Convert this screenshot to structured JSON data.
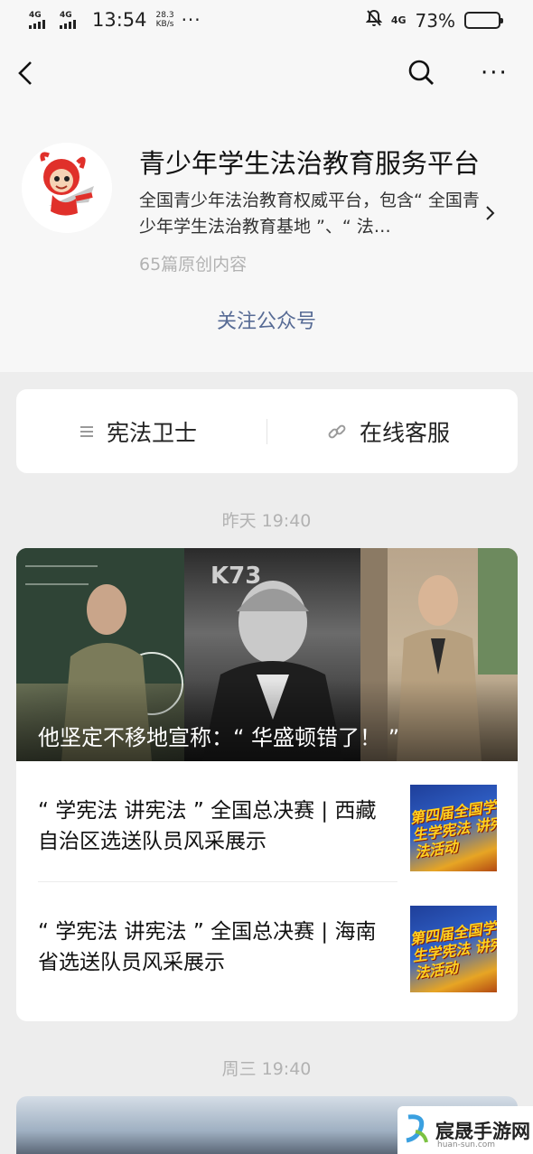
{
  "status_bar": {
    "sim1_network": "4G",
    "sim2_network": "4G",
    "time": "13:54",
    "speed_value": "28.3",
    "speed_unit": "KB/s",
    "dots": "···",
    "signal_right": "4G",
    "battery_text": "73%",
    "battery_level": 0.73
  },
  "nav": {
    "back_icon": "chevron-left-icon",
    "search_icon": "search-icon",
    "more_icon": "more-icon",
    "more_text": "···"
  },
  "account": {
    "name": "青少年学生法治教育服务平台",
    "description": "全国青少年法治教育权威平台，包含“ 全国青少年学生法治教育基地 ”、“ 法…",
    "article_count": "65篇原创内容",
    "follow_label": "关注公众号"
  },
  "menu": {
    "item1_label": "宪法卫士",
    "item1_icon": "list-icon",
    "item2_label": "在线客服",
    "item2_icon": "link-icon"
  },
  "feed": {
    "group1_date": "昨天 19:40",
    "cover_title": "他坚定不移地宣称：“ 华盛顿错了！ ”",
    "watermark": "K73",
    "articles": [
      {
        "title": "“ 学宪法 讲宪法 ”  全国总决赛 | 西藏自治区选送队员风采展示",
        "thumb_text": "第四届全国学生学宪法 讲宪法活动"
      },
      {
        "title": "“ 学宪法 讲宪法 ”  全国总决赛 | 海南省选送队员风采展示",
        "thumb_text": "第四届全国学生学宪法 讲宪法活动"
      }
    ],
    "group2_date": "周三 19:40"
  },
  "watermark_badge": {
    "text": "宸晟手游网",
    "sub": "huan-sun.com"
  },
  "colors": {
    "link": "#576b95",
    "muted": "#b2b2b2",
    "background": "#ededed"
  }
}
